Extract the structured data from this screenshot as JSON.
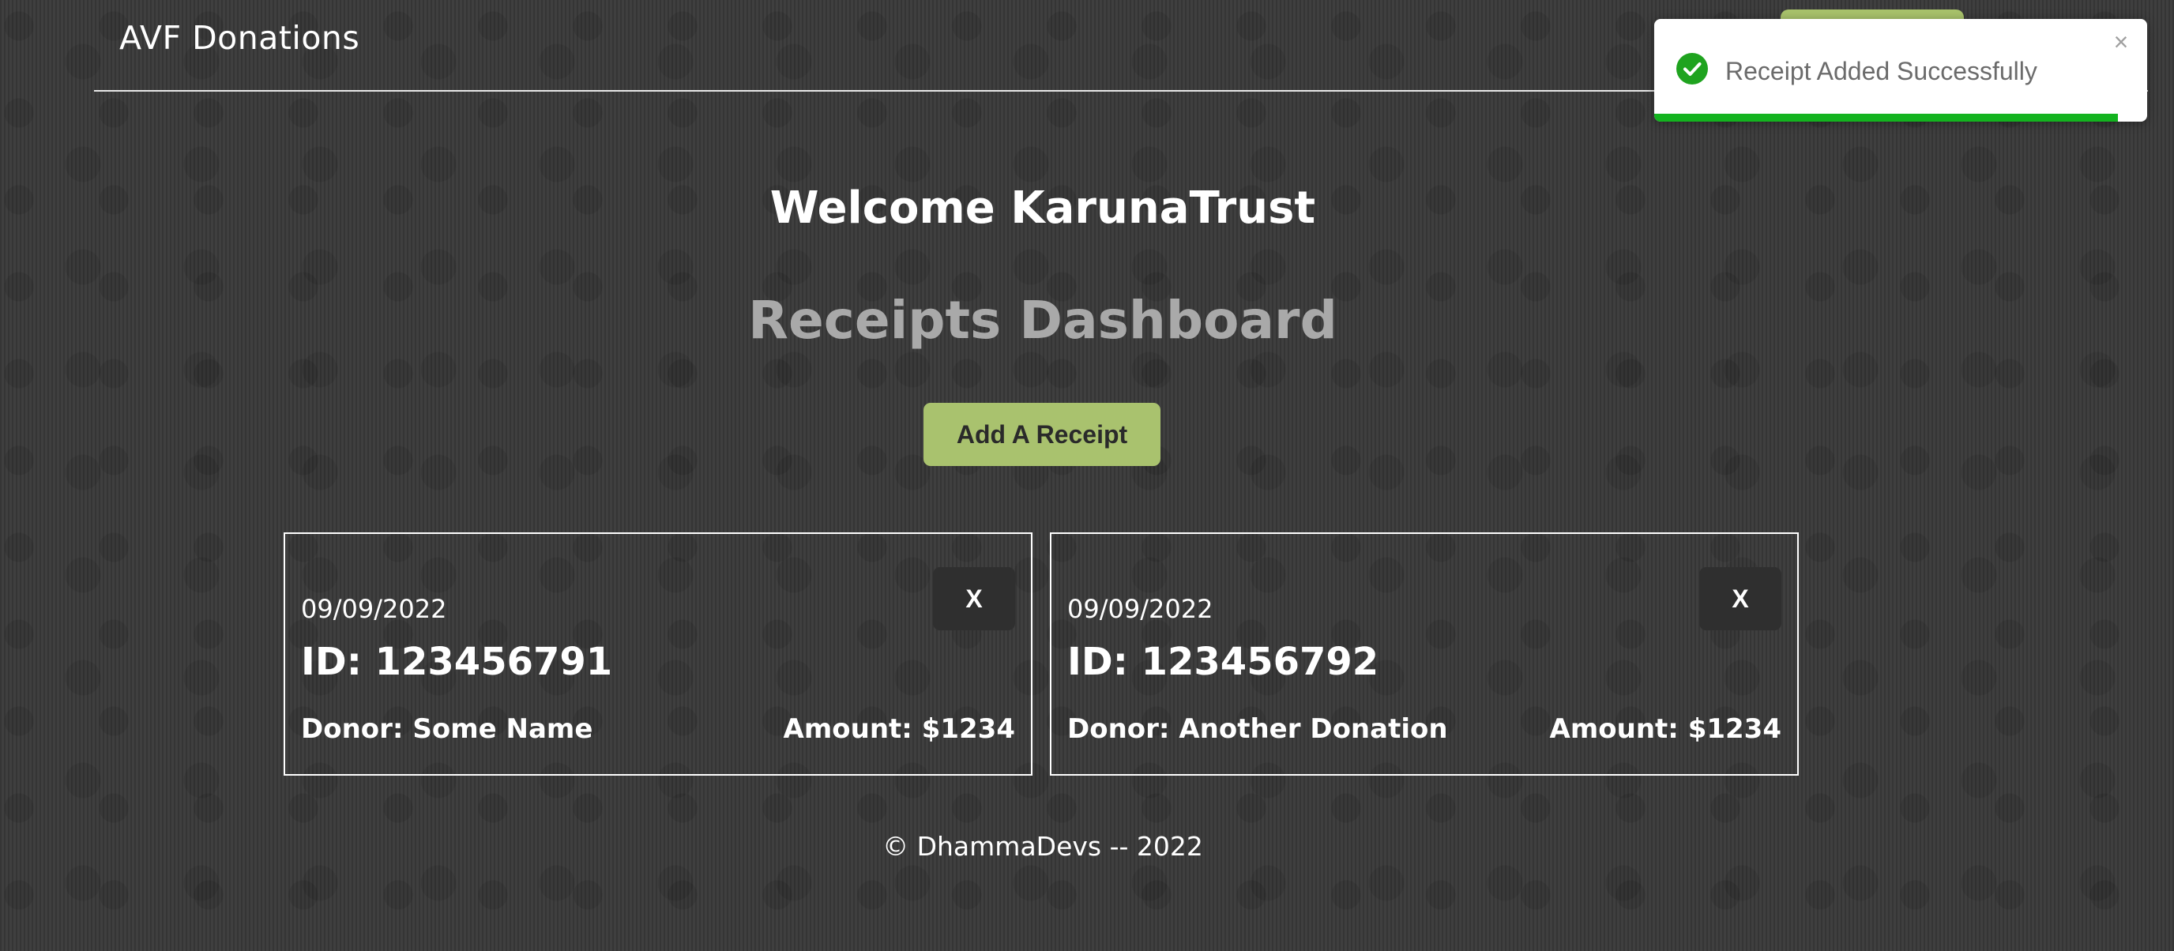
{
  "header": {
    "brand": "AVF Donations"
  },
  "main": {
    "welcome": "Welcome KarunaTrust",
    "subtitle": "Receipts Dashboard",
    "add_button_label": "Add A Receipt"
  },
  "receipts": [
    {
      "date": "09/09/2022",
      "id_text": "ID: 123456791",
      "donor_text": "Donor: Some Name",
      "amount_text": "Amount: $1234",
      "close_label": "X"
    },
    {
      "date": "09/09/2022",
      "id_text": "ID: 123456792",
      "donor_text": "Donor: Another Donation",
      "amount_text": "Amount: $1234",
      "close_label": "X"
    }
  ],
  "footer": {
    "text": "© DhammaDevs -- 2022"
  },
  "toast": {
    "message": "Receipt Added Successfully",
    "close_label": "×",
    "icon": "check-circle-icon",
    "progress": 0.94
  },
  "colors": {
    "accent": "#a9c26e",
    "toast_success": "#1fa31f",
    "subtitle_gray": "#a9a9a9"
  }
}
